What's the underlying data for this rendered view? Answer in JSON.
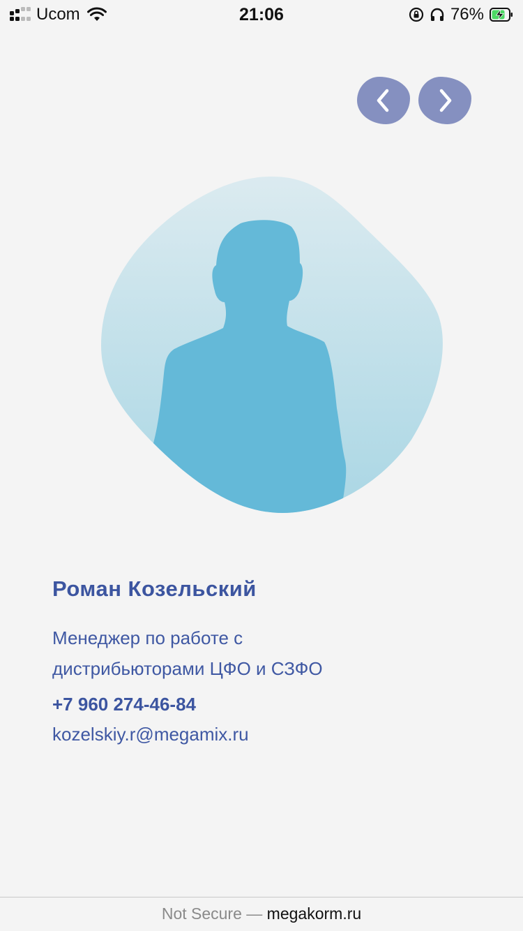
{
  "status_bar": {
    "carrier": "Ucom",
    "time": "21:06",
    "battery_percent": "76%"
  },
  "nav": {
    "prev_icon": "chevron-left-icon",
    "next_icon": "chevron-right-icon",
    "color": "#8590c0"
  },
  "profile": {
    "name": "Роман Козельский",
    "position_line1": "Менеджер по работе с",
    "position_line2": "дистрибьюторами ЦФО и СЗФО",
    "phone": "+7 960 274-46-84",
    "email": "kozelskiy.r@megamix.ru"
  },
  "browser": {
    "security": "Not Secure —",
    "domain": "megakorm.ru"
  },
  "colors": {
    "accent": "#3c55a0",
    "silhouette": "#64b9d8",
    "blob_top": "#dcebf0",
    "blob_bottom": "#a9d6e4"
  }
}
